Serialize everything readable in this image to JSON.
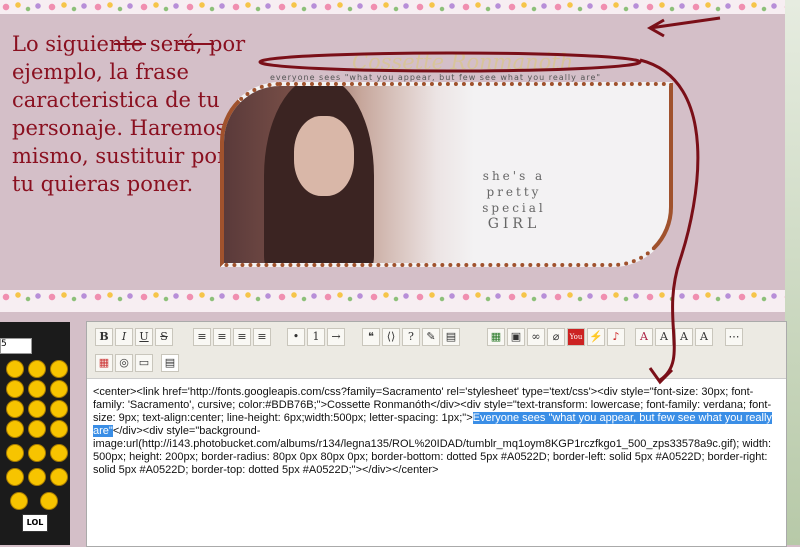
{
  "annotation": {
    "text": "Lo siguiente será, por ejemplo, la frase caracteristica de tu personaje. Haremos lo mismo, sustituir por la que tu quieras poner."
  },
  "preview": {
    "name": "Cossette Ronmanóth",
    "phrase": "Everyone sees \"what you appear, but few see what you really are\"",
    "quote_line1": "she's a",
    "quote_line2": "pretty",
    "quote_line3": "special",
    "quote_line4": "GIRL"
  },
  "sidebar": {
    "select_value": "5",
    "lol_label": "LOL"
  },
  "toolbar": {
    "bold": "B",
    "italic": "I",
    "underline": "U",
    "strike": "S",
    "youtube": "You"
  },
  "code": {
    "before": "<center><link href='http://fonts.googleapis.com/css?family=Sacramento' rel='stylesheet' type='text/css'><div style=\"font-size: 30px; font-family: 'Sacramento', cursive; color:#BDB76B;\">Cossette Ronmanóth</div><div style=\"text-transform: lowercase; font-family: verdana; font-size: 9px; text-align:center; line-height: 6px;width:500px; letter-spacing: 1px;\">",
    "highlighted": "Everyone sees \"what you appear, but few see what you really are\"",
    "after": "</div><div style=\"background-image:url(http://i143.photobucket.com/albums/r134/legna135/ROL%20IDAD/tumblr_mq1oym8KGP1rczfkgo1_500_zps33578a9c.gif); width: 500px; height: 200px; border-radius: 80px 0px 80px 0px; border-bottom: dotted 5px #A0522D; border-left: solid 5px #A0522D; border-right: solid 5px #A0522D; border-top: dotted 5px #A0522D;\"></div></center>"
  },
  "colors": {
    "annotation": "#8a1020",
    "border": "#A0522D",
    "highlight": "#3a8ee6"
  }
}
